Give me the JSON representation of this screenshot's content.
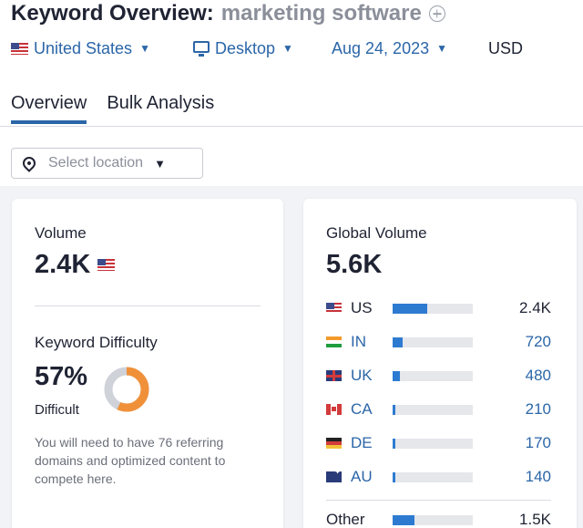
{
  "header": {
    "title": "Keyword Overview:",
    "keyword": "marketing software",
    "add_icon": "plus-circle-icon"
  },
  "filters": {
    "country": "United States",
    "device": "Desktop",
    "date": "Aug 24, 2023",
    "currency": "USD"
  },
  "tabs": [
    {
      "label": "Overview",
      "active": true
    },
    {
      "label": "Bulk Analysis",
      "active": false
    }
  ],
  "location_select": {
    "placeholder": "Select location"
  },
  "volume_card": {
    "volume_label": "Volume",
    "volume_value": "2.4K",
    "kd_label": "Keyword Difficulty",
    "kd_value": "57%",
    "kd_percent": 57,
    "kd_rating": "Difficult",
    "kd_description": "You will need to have 76 referring domains and optimized content to compete here."
  },
  "global_card": {
    "label": "Global Volume",
    "value": "5.6K",
    "countries": [
      {
        "code": "US",
        "value": "2.4K",
        "share": 0.43
      },
      {
        "code": "IN",
        "value": "720",
        "share": 0.13
      },
      {
        "code": "UK",
        "value": "480",
        "share": 0.086
      },
      {
        "code": "CA",
        "value": "210",
        "share": 0.038
      },
      {
        "code": "DE",
        "value": "170",
        "share": 0.03
      },
      {
        "code": "AU",
        "value": "140",
        "share": 0.025
      }
    ],
    "other_label": "Other",
    "other_value": "1.5K",
    "other_share": 0.27
  },
  "colors": {
    "accent": "#2b66a8",
    "bar": "#2d7bd1",
    "difficulty": "#f0913a"
  }
}
